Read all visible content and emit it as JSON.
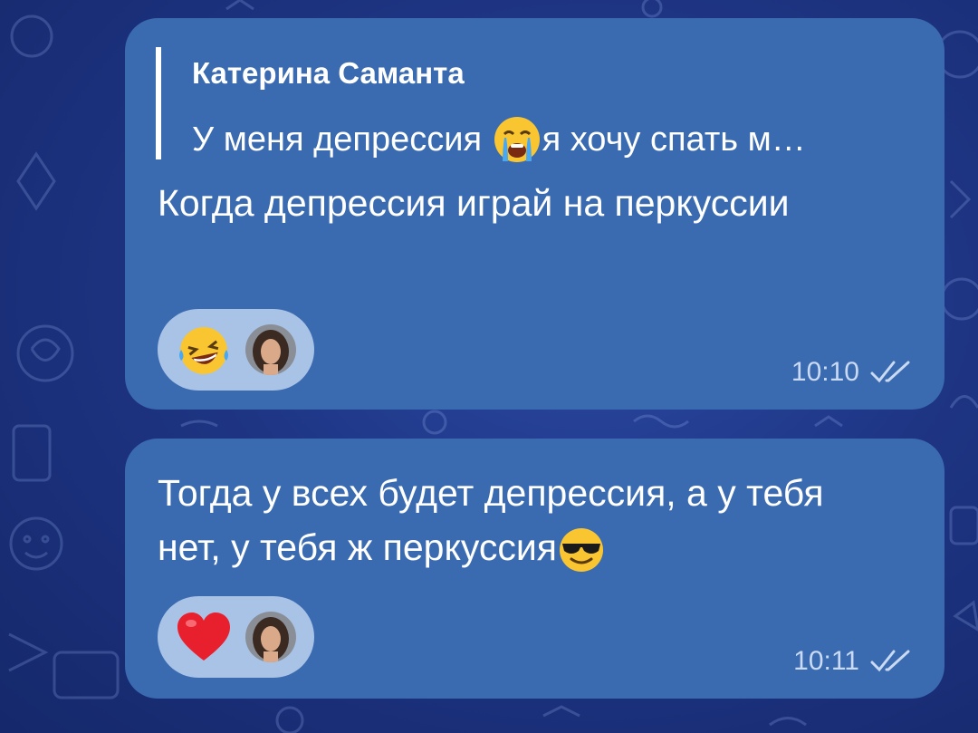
{
  "chat": {
    "messages": [
      {
        "reply_author": "Катерина Саманта",
        "reply_text_before": "У меня депрессия ",
        "reply_emoji": "loudly-crying-face",
        "reply_text_after": "я хочу спать м…",
        "text": "Когда депрессия играй на перкуссии",
        "reaction_emoji": "rolling-on-the-floor-laughing",
        "time": "10:10",
        "status": "read-double-check"
      },
      {
        "text": "Тогда у всех будет депрессия, а у тебя нет, у тебя ж перкуссия",
        "text_emoji": "smiling-face-with-sunglasses",
        "reaction_emoji": "red-heart",
        "time": "10:11",
        "status": "read-double-check"
      }
    ]
  },
  "colors": {
    "bubble": "#3a6ab0",
    "reaction_pill": "#a9c3e6",
    "meta_text": "#c9daf2",
    "background": "#1e3584"
  }
}
